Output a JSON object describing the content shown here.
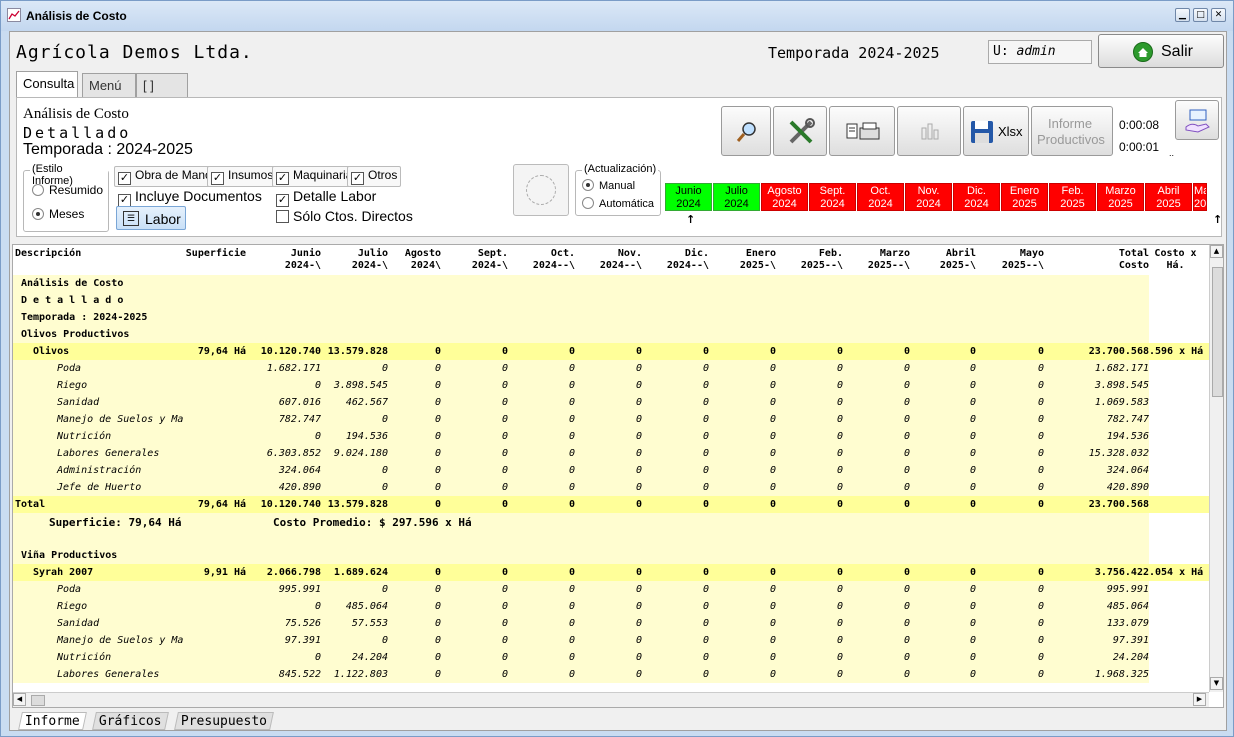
{
  "window": {
    "title": "Análisis de Costo"
  },
  "header": {
    "company": "Agrícola Demos Ltda.",
    "season": "Temporada 2024-2025",
    "user_prefix": "U:",
    "user_name": "admin",
    "exit_label": "Salir"
  },
  "tabs": [
    "Consulta",
    "Menú",
    "[   ]"
  ],
  "report": {
    "title1": "Análisis de Costo",
    "title2": "Detallado",
    "title3": "Temporada : 2024-2025"
  },
  "toolbar": {
    "xlsx_label": "Xlsx",
    "informe_label1": "Informe",
    "informe_label2": "Productivos",
    "time1": "0:00:08",
    "time2": "0:00:01",
    "dots": ".."
  },
  "style_group": {
    "caption": "(Estilo Informe)",
    "resumido": "Resumido",
    "meses": "Meses"
  },
  "filters": {
    "obra": "Obra de Mano",
    "insumos": "Insumos",
    "maquinaria": "Maquinaria",
    "otros": "Otros",
    "incluye_docs": "Incluye Documentos",
    "detalle_labor": "Detalle Labor",
    "solo_directos": "Sólo Ctos. Directos",
    "labor_button": "Labor"
  },
  "update_group": {
    "caption": "(Actualización)",
    "manual": "Manual",
    "automatica": "Automática"
  },
  "month_buttons": [
    {
      "m": "Junio",
      "y": "2024",
      "state": "green"
    },
    {
      "m": "Julio",
      "y": "2024",
      "state": "green"
    },
    {
      "m": "Agosto",
      "y": "2024",
      "state": "red"
    },
    {
      "m": "Sept.",
      "y": "2024",
      "state": "red"
    },
    {
      "m": "Oct.",
      "y": "2024",
      "state": "red"
    },
    {
      "m": "Nov.",
      "y": "2024",
      "state": "red"
    },
    {
      "m": "Dic.",
      "y": "2024",
      "state": "red"
    },
    {
      "m": "Enero",
      "y": "2025",
      "state": "red"
    },
    {
      "m": "Feb.",
      "y": "2025",
      "state": "red"
    },
    {
      "m": "Marzo",
      "y": "2025",
      "state": "red"
    },
    {
      "m": "Abril",
      "y": "2025",
      "state": "red"
    },
    {
      "m": "Ma",
      "y": "20",
      "state": "red"
    }
  ],
  "grid": {
    "headers": [
      {
        "l1": "Descripción",
        "l2": ""
      },
      {
        "l1": "Superficie",
        "l2": ""
      },
      {
        "l1": "Junio",
        "l2": "2024-\\"
      },
      {
        "l1": "Julio",
        "l2": "2024-\\"
      },
      {
        "l1": "Agosto",
        "l2": "2024\\"
      },
      {
        "l1": "Sept.",
        "l2": "2024-\\"
      },
      {
        "l1": "Oct.",
        "l2": "2024--\\"
      },
      {
        "l1": "Nov.",
        "l2": "2024--\\"
      },
      {
        "l1": "Dic.",
        "l2": "2024--\\"
      },
      {
        "l1": "Enero",
        "l2": "2025-\\"
      },
      {
        "l1": "Feb.",
        "l2": "2025--\\"
      },
      {
        "l1": "Marzo",
        "l2": "2025--\\"
      },
      {
        "l1": "Abril",
        "l2": "2025-\\"
      },
      {
        "l1": "Mayo",
        "l2": "2025--\\"
      },
      {
        "l1": "Total Costo",
        "l2": ""
      },
      {
        "l1": "Costo x",
        "l2": "Há."
      }
    ],
    "rows": [
      {
        "kind": "title",
        "text": "Análisis de Costo"
      },
      {
        "kind": "title",
        "text": "D e t a l l a d o"
      },
      {
        "kind": "title",
        "text": "Temporada : 2024-2025"
      },
      {
        "kind": "title",
        "text": "Olivos Productivos"
      },
      {
        "kind": "group",
        "desc": "Olivos",
        "sup": "79,64 Há",
        "vals": [
          "10.120.740",
          "13.579.828",
          "0",
          "0",
          "0",
          "0",
          "0",
          "0",
          "0",
          "0",
          "0",
          "0"
        ],
        "total": "23.700.568",
        "xha": ".596 x Há"
      },
      {
        "kind": "item",
        "desc": "Poda",
        "vals": [
          "1.682.171",
          "0",
          "0",
          "0",
          "0",
          "0",
          "0",
          "0",
          "0",
          "0",
          "0",
          "0"
        ],
        "total": "1.682.171"
      },
      {
        "kind": "item",
        "desc": "Riego",
        "vals": [
          "0",
          "3.898.545",
          "0",
          "0",
          "0",
          "0",
          "0",
          "0",
          "0",
          "0",
          "0",
          "0"
        ],
        "total": "3.898.545"
      },
      {
        "kind": "item",
        "desc": "Sanidad",
        "vals": [
          "607.016",
          "462.567",
          "0",
          "0",
          "0",
          "0",
          "0",
          "0",
          "0",
          "0",
          "0",
          "0"
        ],
        "total": "1.069.583"
      },
      {
        "kind": "item",
        "desc": "Manejo de Suelos y Ma",
        "vals": [
          "782.747",
          "0",
          "0",
          "0",
          "0",
          "0",
          "0",
          "0",
          "0",
          "0",
          "0",
          "0"
        ],
        "total": "782.747"
      },
      {
        "kind": "item",
        "desc": "Nutrición",
        "vals": [
          "0",
          "194.536",
          "0",
          "0",
          "0",
          "0",
          "0",
          "0",
          "0",
          "0",
          "0",
          "0"
        ],
        "total": "194.536"
      },
      {
        "kind": "item",
        "desc": "Labores Generales",
        "vals": [
          "6.303.852",
          "9.024.180",
          "0",
          "0",
          "0",
          "0",
          "0",
          "0",
          "0",
          "0",
          "0",
          "0"
        ],
        "total": "15.328.032"
      },
      {
        "kind": "item",
        "desc": "Administración",
        "vals": [
          "324.064",
          "0",
          "0",
          "0",
          "0",
          "0",
          "0",
          "0",
          "0",
          "0",
          "0",
          "0"
        ],
        "total": "324.064"
      },
      {
        "kind": "item",
        "desc": "Jefe de Huerto",
        "vals": [
          "420.890",
          "0",
          "0",
          "0",
          "0",
          "0",
          "0",
          "0",
          "0",
          "0",
          "0",
          "0"
        ],
        "total": "420.890"
      },
      {
        "kind": "total",
        "desc": "Total",
        "sup": "79,64 Há",
        "vals": [
          "10.120.740",
          "13.579.828",
          "0",
          "0",
          "0",
          "0",
          "0",
          "0",
          "0",
          "0",
          "0",
          "0"
        ],
        "total": "23.700.568"
      },
      {
        "kind": "summary",
        "sup_text": "Superficie: 79,64 Há",
        "avg_text": "Costo Promedio: $ 297.596 x Há"
      },
      {
        "kind": "blank"
      },
      {
        "kind": "title",
        "text": "Viña Productivos"
      },
      {
        "kind": "group",
        "desc": "Syrah 2007",
        "sup": "9,91 Há",
        "vals": [
          "2.066.798",
          "1.689.624",
          "0",
          "0",
          "0",
          "0",
          "0",
          "0",
          "0",
          "0",
          "0",
          "0"
        ],
        "total": "3.756.422",
        "xha": ".054 x Há"
      },
      {
        "kind": "item",
        "desc": "Poda",
        "vals": [
          "995.991",
          "0",
          "0",
          "0",
          "0",
          "0",
          "0",
          "0",
          "0",
          "0",
          "0",
          "0"
        ],
        "total": "995.991"
      },
      {
        "kind": "item",
        "desc": "Riego",
        "vals": [
          "0",
          "485.064",
          "0",
          "0",
          "0",
          "0",
          "0",
          "0",
          "0",
          "0",
          "0",
          "0"
        ],
        "total": "485.064"
      },
      {
        "kind": "item",
        "desc": "Sanidad",
        "vals": [
          "75.526",
          "57.553",
          "0",
          "0",
          "0",
          "0",
          "0",
          "0",
          "0",
          "0",
          "0",
          "0"
        ],
        "total": "133.079"
      },
      {
        "kind": "item",
        "desc": "Manejo de Suelos y Ma",
        "vals": [
          "97.391",
          "0",
          "0",
          "0",
          "0",
          "0",
          "0",
          "0",
          "0",
          "0",
          "0",
          "0"
        ],
        "total": "97.391"
      },
      {
        "kind": "item",
        "desc": "Nutrición",
        "vals": [
          "0",
          "24.204",
          "0",
          "0",
          "0",
          "0",
          "0",
          "0",
          "0",
          "0",
          "0",
          "0"
        ],
        "total": "24.204"
      },
      {
        "kind": "item",
        "desc": "Labores Generales",
        "vals": [
          "845.522",
          "1.122.803",
          "0",
          "0",
          "0",
          "0",
          "0",
          "0",
          "0",
          "0",
          "0",
          "0"
        ],
        "total": "1.968.325"
      }
    ]
  },
  "bottom_tabs": [
    "Informe",
    "Gráficos",
    "Presupuesto"
  ]
}
